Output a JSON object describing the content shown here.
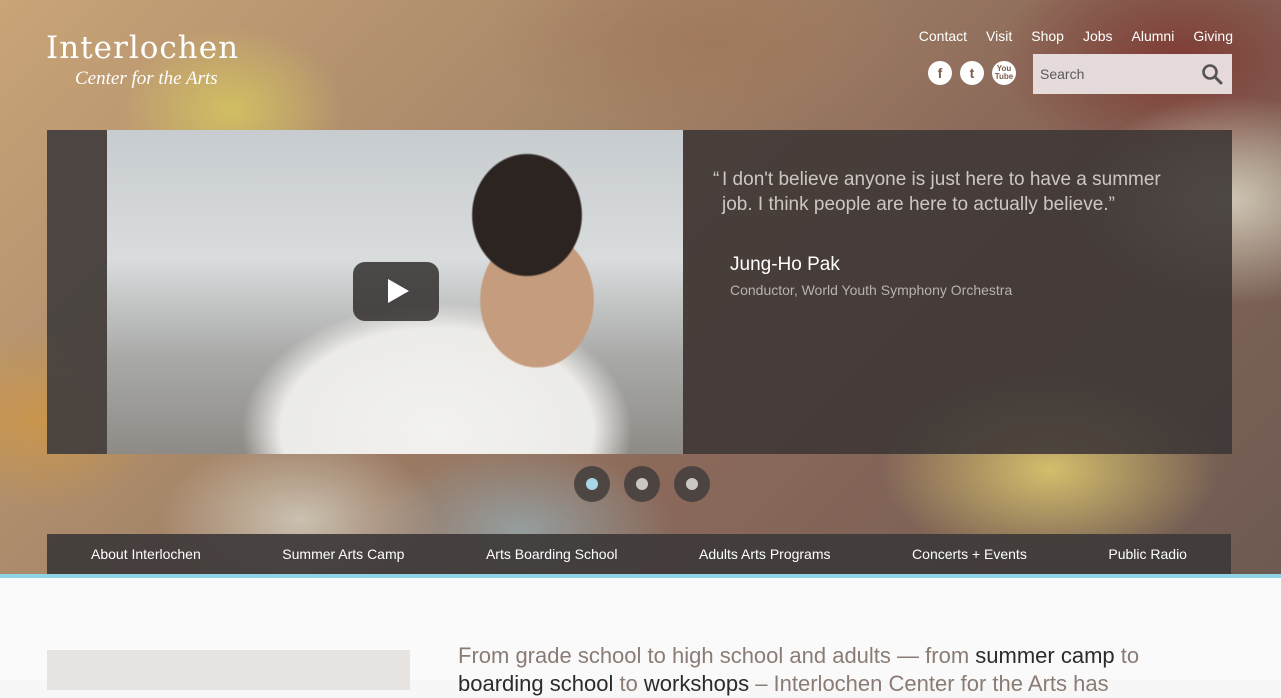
{
  "logo": {
    "name": "Interlochen",
    "tagline": "Center for the Arts"
  },
  "utility_nav": [
    "Contact",
    "Visit",
    "Shop",
    "Jobs",
    "Alumni",
    "Giving"
  ],
  "social": [
    {
      "icon": "facebook-icon",
      "glyph": "f"
    },
    {
      "icon": "twitter-icon",
      "glyph": "t"
    },
    {
      "icon": "youtube-icon",
      "glyph": "You Tube"
    }
  ],
  "search": {
    "placeholder": "Search"
  },
  "slide": {
    "quote_open": "“",
    "quote": "I don't believe anyone is just here to have a summer job. I think people are here to actually believe.”",
    "name": "Jung-Ho Pak",
    "role": "Conductor, World Youth Symphony Orchestra"
  },
  "carousel": {
    "count": 3,
    "active_index": 0
  },
  "main_nav": [
    "About Interlochen",
    "Summer Arts Camp",
    "Arts Boarding School",
    "Adults Arts Programs",
    "Concerts + Events",
    "Public Radio"
  ],
  "intro": {
    "before": "From grade school to high school and adults — from ",
    "link1": "summer camp",
    "between": " to ",
    "link2": "boarding school",
    "mid": " to ",
    "link3": "workshops",
    "after": " – Interlochen Center for the Arts has"
  },
  "colors": {
    "accent_line": "#8fd3e6",
    "active_dot": "#a9d6e6"
  }
}
